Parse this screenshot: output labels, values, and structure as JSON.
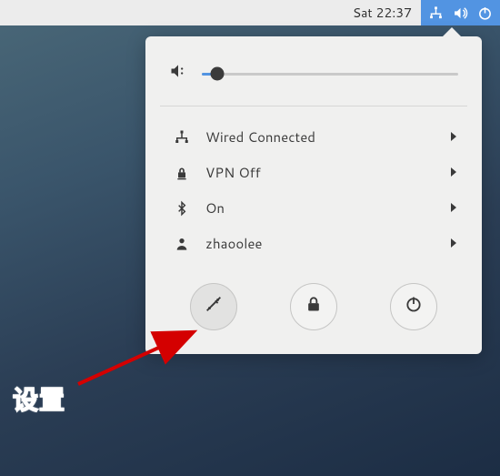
{
  "topbar": {
    "clock": "Sat 22:37"
  },
  "panel": {
    "volume_percent": 6,
    "menu": [
      {
        "icon": "network-wired-icon",
        "label": "Wired Connected",
        "submenu": true
      },
      {
        "icon": "vpn-icon",
        "label": "VPN Off",
        "submenu": true
      },
      {
        "icon": "bluetooth-icon",
        "label": "On",
        "submenu": true
      },
      {
        "icon": "user-icon",
        "label": "zhaoolee",
        "submenu": true
      }
    ],
    "actions": {
      "settings_icon": "settings-icon",
      "lock_icon": "lock-icon",
      "power_icon": "power-icon"
    }
  },
  "annotation": {
    "label": "设置"
  }
}
